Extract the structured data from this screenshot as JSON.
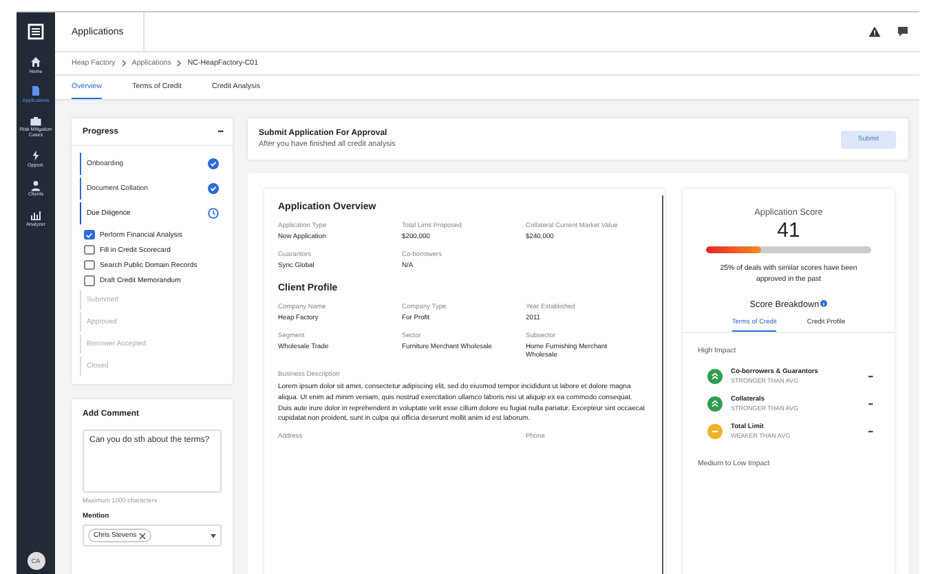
{
  "sidebar": {
    "items": [
      {
        "label": "Home",
        "selected": false
      },
      {
        "label": "Applications",
        "selected": true
      },
      {
        "label": "Risk Mitigation Cases",
        "selected": false
      },
      {
        "label": "Opport.",
        "selected": false
      },
      {
        "label": "Clients",
        "selected": false
      },
      {
        "label": "Analyzer",
        "selected": false
      }
    ],
    "avatar": "CA"
  },
  "header": {
    "title": "Applications"
  },
  "breadcrumb": [
    "Heap Factory",
    "Applications",
    "NC-HeapFactory-C01"
  ],
  "tabs": [
    {
      "label": "Overview",
      "selected": true
    },
    {
      "label": "Terms of Credit",
      "selected": false
    },
    {
      "label": "Credit Analysis",
      "selected": false
    }
  ],
  "progress": {
    "title": "Progress",
    "menu": "•••",
    "steps": [
      {
        "kind": "stage",
        "label": "Onboarding",
        "completed": true,
        "current": false,
        "disabled": false
      },
      {
        "kind": "stage",
        "label": "Document Collation",
        "completed": true,
        "current": false,
        "disabled": false
      },
      {
        "kind": "stage",
        "label": "Due Diligence",
        "completed": false,
        "current": true,
        "disabled": false
      },
      {
        "kind": "task",
        "label": "Perform Financial Analysis",
        "checked": true
      },
      {
        "kind": "task",
        "label": "Fill in Credit Scorecard",
        "checked": false
      },
      {
        "kind": "task",
        "label": "Search Public Domain Records",
        "checked": false
      },
      {
        "kind": "task",
        "label": "Draft Credit Memorandum",
        "checked": false
      },
      {
        "kind": "stage",
        "label": "Submitted",
        "completed": false,
        "current": false,
        "disabled": true
      },
      {
        "kind": "stage",
        "label": "Approved",
        "completed": false,
        "current": false,
        "disabled": true
      },
      {
        "kind": "stage",
        "label": "Borrower Accepted",
        "completed": false,
        "current": false,
        "disabled": true
      },
      {
        "kind": "stage",
        "label": "Closed",
        "completed": false,
        "current": false,
        "disabled": true
      }
    ]
  },
  "comment": {
    "title": "Add Comment",
    "value": "Can you do sth about the terms?",
    "hint": "Maximum 1000 characters",
    "mention_label": "Mention",
    "mentions": [
      "Chris Stevens"
    ]
  },
  "submit": {
    "title": "Submit Application For Approval",
    "subtitle": "After you have finished all credit analysis",
    "button": "Submit",
    "disabled": true
  },
  "overview": {
    "title": "Application Overview",
    "fields": [
      {
        "label": "Application Type",
        "value": "New Application"
      },
      {
        "label": "Total Limit Proposed",
        "value": "$200,000"
      },
      {
        "label": "Collateral Current Market Value",
        "value": "$240,000"
      },
      {
        "label": "Guarantors",
        "value": "Sync Global"
      },
      {
        "label": "Co-borrowers",
        "value": "N/A"
      }
    ]
  },
  "client_profile": {
    "title": "Client Profile",
    "fields": [
      {
        "label": "Company Name",
        "value": "Heap Factory"
      },
      {
        "label": "Company Type",
        "value": "For Profit"
      },
      {
        "label": "Year Established",
        "value": "2011"
      },
      {
        "label": "Segment",
        "value": "Wholesale Trade"
      },
      {
        "label": "Sector",
        "value": "Furniture Merchant Wholesale"
      },
      {
        "label": "Subsector",
        "value": "Home Furnishing Merchant Wholesale"
      }
    ],
    "description_label": "Business Description",
    "description": "Lorem ipsum dolor sit amet, consectetur adipiscing elit, sed do eiusmod tempor incididunt ut labore et dolore magna aliqua. Ut enim ad minim veniam, quis nostrud exercitation ullamco laboris nisi ut aliquip ex ea commodo consequat. Duis aute irure dolor in reprehenderit in voluptate velit esse cillum dolore eu fugiat nulla pariatur. Excepteur sint occaecat cupidatat non proident, sunt in culpa qui officia deserunt mollit anim id est laborum.",
    "more_labels": [
      "Address",
      "Phone"
    ]
  },
  "score": {
    "title": "Application Score",
    "value": "41",
    "level": 0.33,
    "note": "25% of deals with similar scores have been approved in the past",
    "breakdown_title": "Score Breakdown",
    "tabs": [
      {
        "label": "Terms of Credit",
        "selected": true
      },
      {
        "label": "Credit Profile",
        "selected": false
      }
    ],
    "high_label": "High Impact",
    "factors": [
      {
        "name": "Co-borrowers & Guarantors",
        "rating": "STRONGER THAN AVG",
        "kind": "up",
        "color": "#2e9e4f"
      },
      {
        "name": "Collaterals",
        "rating": "STRONGER THAN AVG",
        "kind": "up",
        "color": "#2e9e4f"
      },
      {
        "name": "Total Limit",
        "rating": "WEAKER THAN AVG",
        "kind": "neutral",
        "color": "#f0b323"
      }
    ],
    "factor_menu": "•••",
    "low_label": "Medium to Low Impact"
  }
}
